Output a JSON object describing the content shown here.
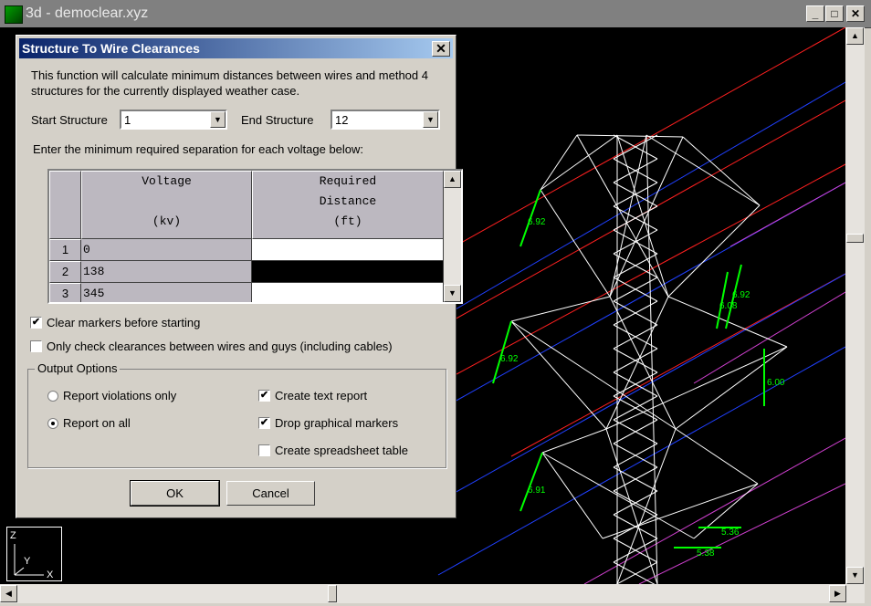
{
  "window": {
    "title": "3d - democlear.xyz",
    "min_label": "_",
    "max_label": "□",
    "close_label": "✕"
  },
  "viewport": {
    "labels": [
      "6.92",
      "6.92",
      "6.92",
      "6.08",
      "6.00",
      "6.91",
      "5.36",
      "5.38"
    ],
    "axis": {
      "z": "Z",
      "y": "Y",
      "x": "X"
    },
    "colors": {
      "background": "#000000",
      "tower": "#ffffff",
      "marker": "#00ff00",
      "wire_red": "#ff2020",
      "wire_blue": "#2040ff",
      "wire_magenta": "#d040d0"
    }
  },
  "dialog": {
    "title": "Structure To Wire Clearances",
    "close_label": "✕",
    "description": "This function will calculate minimum distances between wires and method 4 structures for the currently displayed weather case.",
    "start_label": "Start Structure",
    "start_value": "1",
    "end_label": "End Structure",
    "end_value": "12",
    "instruction": "Enter the minimum required separation for each voltage below:",
    "table": {
      "col1": {
        "line1": "Voltage",
        "line2": "(kv)"
      },
      "col2": {
        "line1": "Required",
        "line2": "Distance",
        "line3": "(ft)"
      },
      "rows": [
        {
          "num": "1",
          "voltage": "0",
          "distance": ""
        },
        {
          "num": "2",
          "voltage": "138",
          "distance": ""
        },
        {
          "num": "3",
          "voltage": "345",
          "distance": ""
        }
      ]
    },
    "clear_markers": {
      "label": "Clear markers before starting",
      "checked": true
    },
    "only_guys": {
      "label": "Only check clearances between wires and  guys (including cables)",
      "checked": false
    },
    "output_options": {
      "label": "Output Options",
      "report_violations": "Report violations only",
      "report_all": "Report on all",
      "selected": "report_all",
      "create_text": {
        "label": "Create text report",
        "checked": true
      },
      "drop_markers": {
        "label": "Drop graphical markers",
        "checked": true
      },
      "create_spreadsheet": {
        "label": "Create spreadsheet table",
        "checked": false
      }
    },
    "ok_label": "OK",
    "cancel_label": "Cancel"
  }
}
